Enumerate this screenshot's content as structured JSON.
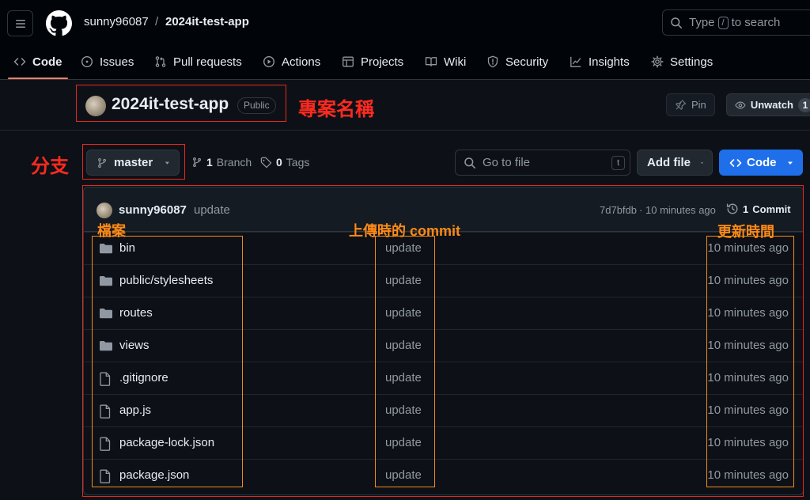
{
  "header": {
    "owner": "sunny96087",
    "separator": "/",
    "repo": "2024it-test-app",
    "search": {
      "prefix": "Type",
      "key": "/",
      "suffix": "to search"
    }
  },
  "nav": {
    "tabs": [
      {
        "label": "Code",
        "icon": "code-icon",
        "selected": true
      },
      {
        "label": "Issues",
        "icon": "issue-opened-icon"
      },
      {
        "label": "Pull requests",
        "icon": "git-pull-request-icon"
      },
      {
        "label": "Actions",
        "icon": "play-icon"
      },
      {
        "label": "Projects",
        "icon": "table-icon"
      },
      {
        "label": "Wiki",
        "icon": "book-icon"
      },
      {
        "label": "Security",
        "icon": "shield-icon"
      },
      {
        "label": "Insights",
        "icon": "graph-icon"
      },
      {
        "label": "Settings",
        "icon": "gear-icon"
      }
    ],
    "accent": "#f78166"
  },
  "repo_header": {
    "name": "2024it-test-app",
    "visibility": "Public",
    "pin_label": "Pin",
    "watch_label": "Unwatch",
    "watch_count": "1"
  },
  "toolbar": {
    "branch": "master",
    "branch_count": "1",
    "branch_label": "Branch",
    "tag_count": "0",
    "tag_label": "Tags",
    "goto_placeholder": "Go to file",
    "goto_key": "t",
    "add_file_label": "Add file",
    "code_label": "Code",
    "code_button_color": "#1f6feb"
  },
  "commit_bar": {
    "author": "sunny96087",
    "message": "update",
    "hash": "7d7bfdb",
    "dot": "·",
    "time": "10 minutes ago",
    "commit_count": "1",
    "commit_label": "Commit"
  },
  "files": [
    {
      "name": "bin",
      "type": "folder",
      "message": "update",
      "age": "10 minutes ago"
    },
    {
      "name": "public/stylesheets",
      "type": "folder",
      "message": "update",
      "age": "10 minutes ago"
    },
    {
      "name": "routes",
      "type": "folder",
      "message": "update",
      "age": "10 minutes ago"
    },
    {
      "name": "views",
      "type": "folder",
      "message": "update",
      "age": "10 minutes ago"
    },
    {
      "name": ".gitignore",
      "type": "file",
      "message": "update",
      "age": "10 minutes ago"
    },
    {
      "name": "app.js",
      "type": "file",
      "message": "update",
      "age": "10 minutes ago"
    },
    {
      "name": "package-lock.json",
      "type": "file",
      "message": "update",
      "age": "10 minutes ago"
    },
    {
      "name": "package.json",
      "type": "file",
      "message": "update",
      "age": "10 minutes ago"
    }
  ],
  "annotations": {
    "project_name": "專案名稱",
    "branch": "分支",
    "files": "檔案",
    "commit": "上傳時的 commit",
    "updated": "更新時間",
    "red": "#e5271f",
    "orange": "#f08a1c"
  }
}
